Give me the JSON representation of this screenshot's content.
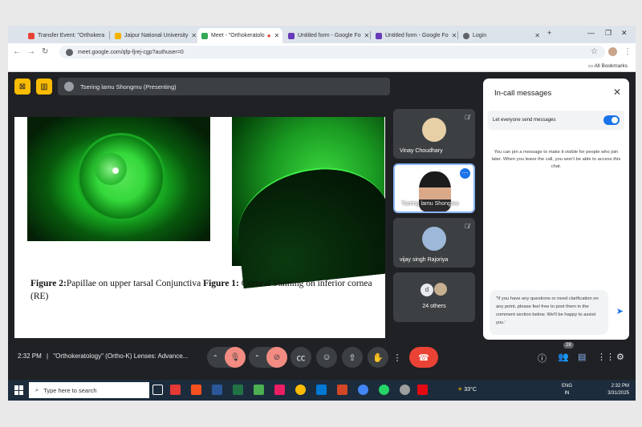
{
  "browser": {
    "tabs": [
      {
        "label": "Transfer Event: \"Orthokera",
        "color": "#ea4335",
        "active": false
      },
      {
        "label": "Jaipur National University",
        "color": "#f4b400",
        "active": false
      },
      {
        "label": "Meet - \"Orthokeratolo",
        "color": "#34a853",
        "active": true
      },
      {
        "label": "Untitled form - Google Fo",
        "color": "#673ab7",
        "active": false
      },
      {
        "label": "Untitled form - Google Fo",
        "color": "#673ab7",
        "active": false
      },
      {
        "label": "Login",
        "color": "#5f6368",
        "active": false
      }
    ],
    "url": "meet.google.com/qfp-fjrej-cgp?authuser=0",
    "bookmarks_label": "All Bookmarks"
  },
  "meet": {
    "presenting": "Tsering lamu Shongmu (Presenting)",
    "slide_caption": {
      "fig2_label": "Figure 2:",
      "fig2_text": "Papillae on upper tarsal Conjunctiva ",
      "fig1_label": "Figure 1:",
      "fig1_text": "  Corneal Staining on inferior cornea (RE)"
    },
    "participants": [
      {
        "name": "Vinay Choudhary"
      },
      {
        "name": "Tsering lamu Shongmu"
      },
      {
        "name": "vijay singh Rajoriya"
      },
      {
        "name": "24 others",
        "avatar_letter": "d"
      }
    ],
    "chat": {
      "title": "In-call messages",
      "permission_label": "Let everyone send messages",
      "pin_info": "You can pin a message to make it visible for people who join later. When you leave the call, you won't be able to access this chat.",
      "draft": "\"If you have any questions or need clarification on any point, please feel free to post them in the comment section below. We'll be happy to assist you.'"
    },
    "bottom": {
      "time": "2:32 PM",
      "separator": "|",
      "meeting_title": "\"Orthokeratology\" (Ortho-K) Lenses: Advance...",
      "people_count": "28"
    }
  },
  "taskbar": {
    "search_placeholder": "Type here to search",
    "weather": "33°C",
    "lang_top": "ENG",
    "lang_bottom": "IN",
    "clock_time": "2:32 PM",
    "clock_date": "3/31/2025"
  }
}
